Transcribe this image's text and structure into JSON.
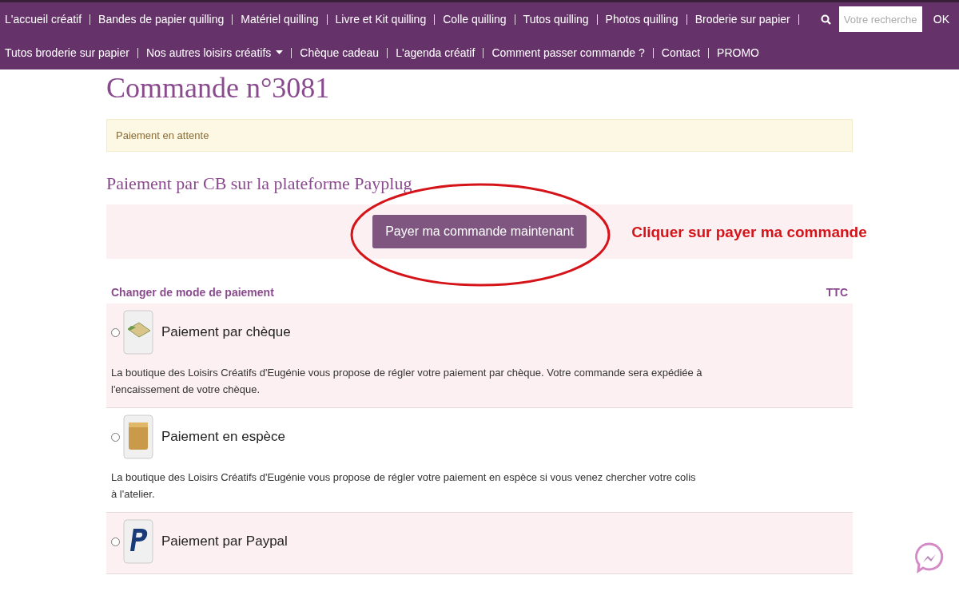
{
  "nav": {
    "rows": [
      {
        "trailing_separator": true,
        "items": [
          {
            "label": "L'accueil créatif",
            "has_dropdown": false
          },
          {
            "label": "Bandes de papier quilling",
            "has_dropdown": false
          },
          {
            "label": "Matériel quilling",
            "has_dropdown": false
          },
          {
            "label": "Livre et Kit quilling",
            "has_dropdown": false
          },
          {
            "label": "Colle quilling",
            "has_dropdown": false
          },
          {
            "label": "Tutos quilling",
            "has_dropdown": false
          },
          {
            "label": "Photos quilling",
            "has_dropdown": false
          },
          {
            "label": "Broderie sur papier",
            "has_dropdown": false
          }
        ]
      },
      {
        "trailing_separator": false,
        "items": [
          {
            "label": "Tutos broderie sur papier",
            "has_dropdown": false
          },
          {
            "label": "Nos autres loisirs créatifs",
            "has_dropdown": true
          },
          {
            "label": "Chèque cadeau",
            "has_dropdown": false
          },
          {
            "label": "L'agenda créatif",
            "has_dropdown": false
          },
          {
            "label": "Comment passer commande ?",
            "has_dropdown": false
          },
          {
            "label": "Contact",
            "has_dropdown": false
          },
          {
            "label": "PROMO",
            "has_dropdown": false
          }
        ]
      }
    ],
    "search": {
      "placeholder": "Votre recherche",
      "button": "OK"
    }
  },
  "title": "Commande n°3081",
  "alert": "Paiement en attente",
  "payplug": {
    "heading": "Paiement par CB sur la plateforme Payplug",
    "button": "Payer ma commande maintenant",
    "annotation": "Cliquer sur payer ma commande"
  },
  "methods": {
    "header": "Changer de mode de paiement",
    "column_2": "TTC",
    "items": [
      {
        "kind": "cheque",
        "label": "Paiement par chèque",
        "selected": false,
        "description": "La boutique des Loisirs Créatifs d'Eugénie vous propose de régler votre paiement par chèque. Votre commande sera expédiée à l'encaissement de votre chèque."
      },
      {
        "kind": "cash",
        "label": "Paiement en espèce",
        "selected": false,
        "description": "La boutique des Loisirs Créatifs d'Eugénie vous propose de régler votre paiement en espèce si vous venez chercher votre colis à l'atelier."
      },
      {
        "kind": "paypal",
        "label": "Paiement par Paypal",
        "selected": false
      }
    ]
  }
}
